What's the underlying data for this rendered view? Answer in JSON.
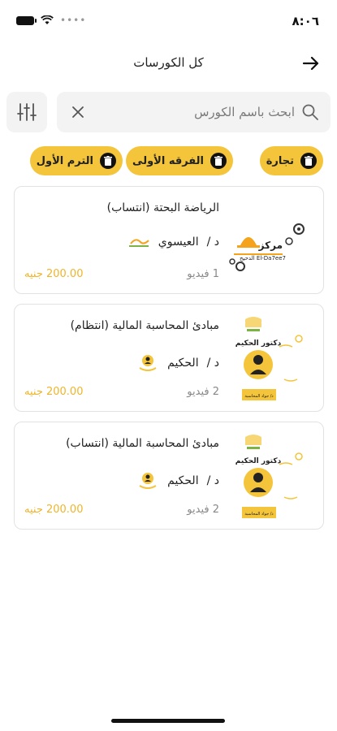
{
  "status_bar": {
    "time": "٨:٠٦"
  },
  "header": {
    "title": "كل الكورسات"
  },
  "search": {
    "placeholder": "ابحث باسم الكورس"
  },
  "filters": [
    {
      "label": "تجارة"
    },
    {
      "label": "الفرقه الأولى"
    },
    {
      "label": "الترم الأول"
    }
  ],
  "courses": [
    {
      "title": "الرياضة البحتة (انتساب)",
      "instructor_prefix": "د /",
      "instructor": "العيسوي",
      "videos": "1 فيديو",
      "price": "200.00 جنيه",
      "thumb_text": "مركز",
      "thumb_subtext": "الدحيح El-Da7ee7"
    },
    {
      "title": "مبادئ المحاسبة المالية (انتظام)",
      "instructor_prefix": "د /",
      "instructor": "الحكيم",
      "videos": "2 فيديو",
      "price": "200.00 جنيه",
      "thumb_text": "دكتور الحكيم",
      "thumb_subtext": "د/ جواد المحاسبة"
    },
    {
      "title": "مبادئ المحاسبة المالية (انتساب)",
      "instructor_prefix": "د /",
      "instructor": "الحكيم",
      "videos": "2 فيديو",
      "price": "200.00 جنيه",
      "thumb_text": "دكتور الحكيم",
      "thumb_subtext": "د/ جواد المحاسبة"
    }
  ],
  "colors": {
    "accent": "#f4c43a",
    "price": "#f0b429"
  },
  "icons": [
    "battery-icon",
    "wifi-icon",
    "arrow-right-icon",
    "search-icon",
    "close-icon",
    "sliders-icon",
    "trash-icon"
  ]
}
